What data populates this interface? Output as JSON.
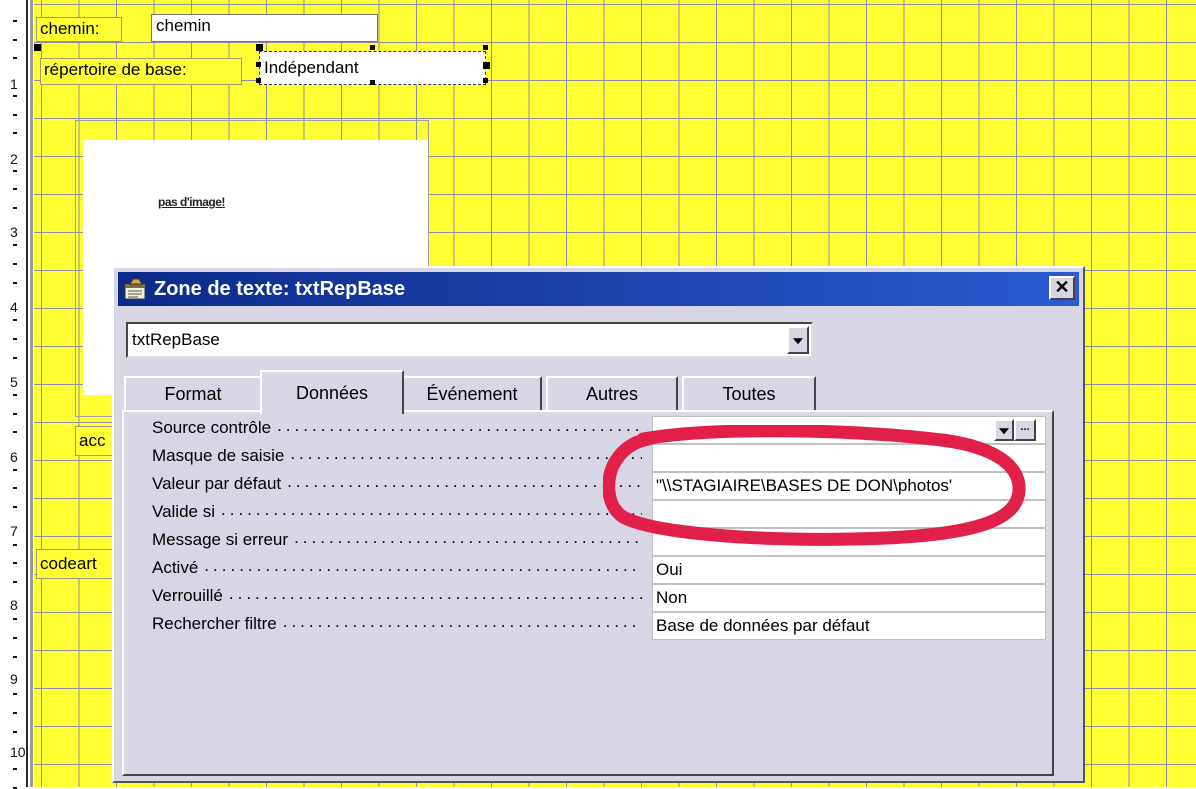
{
  "ruler": {
    "numbers": [
      "1",
      "2",
      "3",
      "4",
      "5",
      "6",
      "7",
      "8",
      "9",
      "10"
    ]
  },
  "form": {
    "chemin_label": "chemin:",
    "chemin_textbox": "chemin",
    "repertoire_label": "répertoire de base:",
    "repertoire_textbox": "Indépendant",
    "image_placeholder": "pas d'image!",
    "acc_label": "acc",
    "codeart_label": "codeart"
  },
  "dialog": {
    "title": "Zone de texte: txtRepBase",
    "close_glyph": "✕",
    "combo_value": "txtRepBase",
    "tabs": [
      {
        "label": "Format"
      },
      {
        "label": "Données"
      },
      {
        "label": "Événement"
      },
      {
        "label": "Autres"
      },
      {
        "label": "Toutes"
      }
    ],
    "active_tab": "Données",
    "build_glyph": "...",
    "properties": [
      {
        "label": "Source contrôle",
        "value": ""
      },
      {
        "label": "Masque de saisie",
        "value": ""
      },
      {
        "label": "Valeur par défaut",
        "value": "\"\\\\STAGIAIRE\\BASES DE DON\\photos'"
      },
      {
        "label": "Valide si",
        "value": ""
      },
      {
        "label": "Message si erreur",
        "value": ""
      },
      {
        "label": "Activé",
        "value": "Oui"
      },
      {
        "label": "Verrouillé",
        "value": "Non"
      },
      {
        "label": "Rechercher filtre",
        "value": "Base de données par défaut"
      }
    ]
  },
  "colors": {
    "grid_background": "#ffff33",
    "dialog_face": "#d8d6e4",
    "title_bar": "#0c2a8a",
    "annotation": "#e0204a"
  },
  "icons": {
    "title_icon": "properties-sheet-icon",
    "close": "close-icon",
    "dropdown": "chevron-down-icon",
    "build": "ellipsis-build-icon"
  }
}
